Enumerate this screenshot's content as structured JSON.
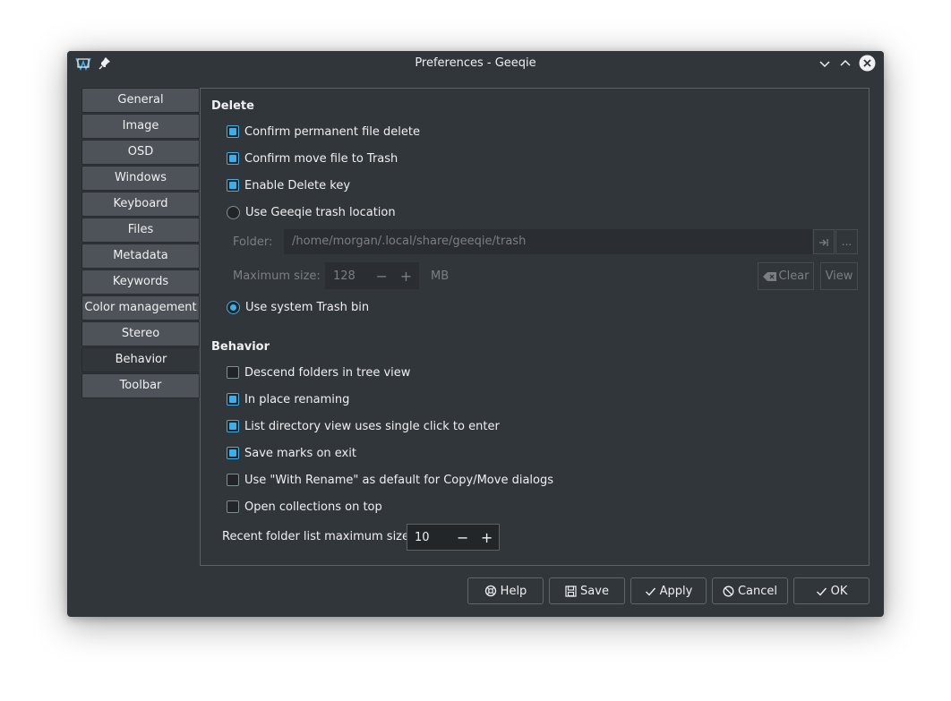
{
  "window": {
    "title": "Preferences - Geeqie"
  },
  "tabs": [
    {
      "label": "General"
    },
    {
      "label": "Image"
    },
    {
      "label": "OSD"
    },
    {
      "label": "Windows"
    },
    {
      "label": "Keyboard"
    },
    {
      "label": "Files"
    },
    {
      "label": "Metadata"
    },
    {
      "label": "Keywords"
    },
    {
      "label": "Color management"
    },
    {
      "label": "Stereo"
    },
    {
      "label": "Behavior",
      "active": true
    },
    {
      "label": "Toolbar"
    }
  ],
  "delete": {
    "title": "Delete",
    "confirm_permanent": {
      "label": "Confirm permanent file delete",
      "checked": true
    },
    "confirm_trash": {
      "label": "Confirm move file to Trash",
      "checked": true
    },
    "enable_delete_key": {
      "label": "Enable Delete key",
      "checked": true
    },
    "use_geeqie_trash": {
      "label": "Use Geeqie trash location",
      "selected": false
    },
    "folder_label": "Folder:",
    "folder_value": "/home/morgan/.local/share/geeqie/trash",
    "folder_more": "...",
    "max_size_label": "Maximum size:",
    "max_size_value": "128",
    "max_size_unit": "MB",
    "clear_label": "Clear",
    "view_label": "View",
    "use_system_trash": {
      "label": "Use system Trash bin",
      "selected": true
    }
  },
  "behavior": {
    "title": "Behavior",
    "descend_folders": {
      "label": "Descend folders in tree view",
      "checked": false
    },
    "in_place_renaming": {
      "label": "In place renaming",
      "checked": true
    },
    "single_click": {
      "label": "List directory view uses single click to enter",
      "checked": true
    },
    "save_marks": {
      "label": "Save marks on exit",
      "checked": true
    },
    "with_rename": {
      "label": "Use \"With Rename\" as default for Copy/Move dialogs",
      "checked": false
    },
    "collections_on_top": {
      "label": "Open collections on top",
      "checked": false
    },
    "recent_label": "Recent folder list maximum size",
    "recent_value": "10"
  },
  "buttons": {
    "help": "Help",
    "save": "Save",
    "apply": "Apply",
    "cancel": "Cancel",
    "ok": "OK"
  },
  "colors": {
    "accent": "#3daee9",
    "window_bg": "#31363b",
    "text": "#eff0f1"
  }
}
